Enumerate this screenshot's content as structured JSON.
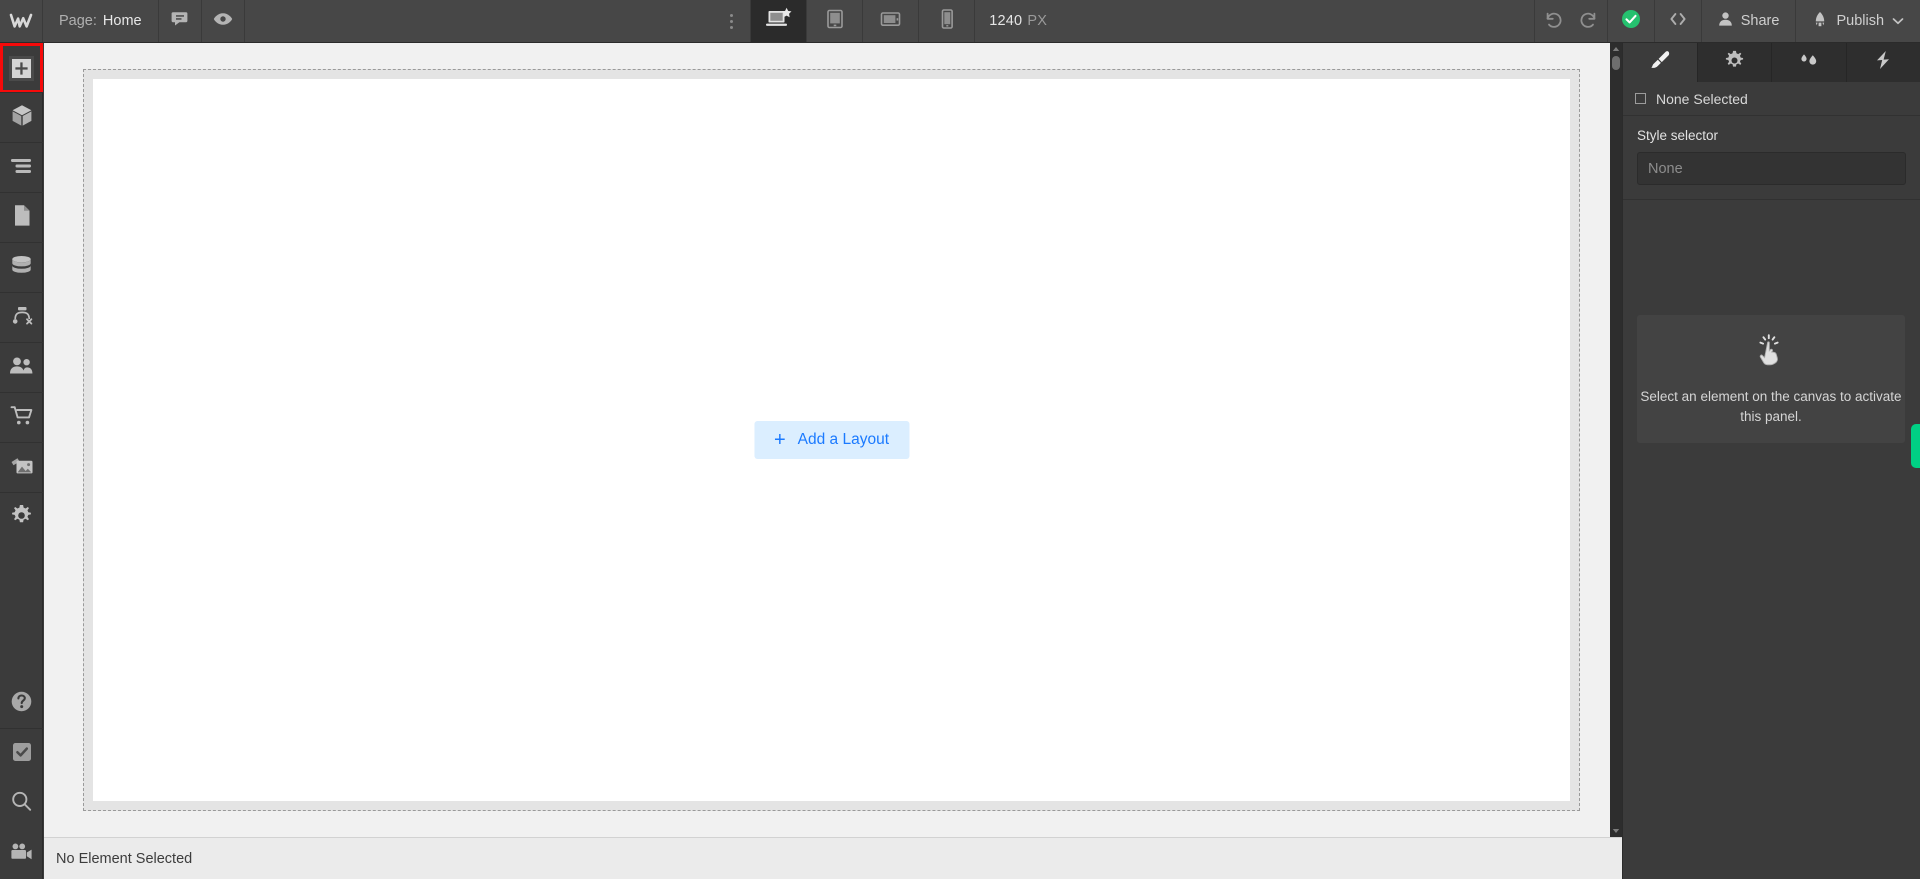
{
  "topbar": {
    "logo_icon": "webflow-logo-icon",
    "page_label": "Page:",
    "page_name": "Home",
    "comments_icon": "comment-icon",
    "preview_icon": "eye-preview-icon",
    "kebab_icon": "more-options-icon",
    "breakpoints": [
      {
        "name": "breakpoint-desktop-base",
        "icon": "desktop-star-icon",
        "active": true
      },
      {
        "name": "breakpoint-tablet",
        "icon": "tablet-icon",
        "active": false
      },
      {
        "name": "breakpoint-tablet-landscape",
        "icon": "tablet-landscape-icon",
        "active": false
      },
      {
        "name": "breakpoint-mobile",
        "icon": "mobile-icon",
        "active": false
      }
    ],
    "canvas_width_value": "1240",
    "canvas_width_unit": "PX",
    "undo_icon": "undo-icon",
    "redo_icon": "redo-icon",
    "status_icon": "saved-check-icon",
    "code_icon": "code-brackets-icon",
    "share_label": "Share",
    "share_icon": "person-icon",
    "publish_label": "Publish",
    "publish_icon": "rocket-icon",
    "publish_chevron": "chevron-down-icon",
    "accent_green": "#25c16f"
  },
  "left_rail": {
    "items": [
      {
        "name": "sidebar-item-add-elements",
        "icon": "plus-icon",
        "highlighted": true
      },
      {
        "name": "sidebar-item-components",
        "icon": "cube-icon",
        "highlighted": false
      },
      {
        "name": "sidebar-item-navigator",
        "icon": "navigator-layers-icon",
        "highlighted": false
      },
      {
        "name": "sidebar-item-pages",
        "icon": "page-document-icon",
        "highlighted": false
      },
      {
        "name": "sidebar-item-cms",
        "icon": "database-icon",
        "highlighted": false
      },
      {
        "name": "sidebar-item-logic",
        "icon": "logic-flow-icon",
        "highlighted": false
      },
      {
        "name": "sidebar-item-users",
        "icon": "people-icon",
        "highlighted": false
      },
      {
        "name": "sidebar-item-ecommerce",
        "icon": "shopping-cart-icon",
        "highlighted": false
      },
      {
        "name": "sidebar-item-assets",
        "icon": "images-assets-icon",
        "highlighted": false
      },
      {
        "name": "sidebar-item-settings",
        "icon": "gear-icon",
        "highlighted": false
      }
    ],
    "bottom_items": [
      {
        "name": "sidebar-item-help",
        "icon": "question-help-icon"
      },
      {
        "name": "sidebar-item-audit",
        "icon": "checkmark-audit-icon"
      },
      {
        "name": "sidebar-item-search",
        "icon": "search-icon"
      },
      {
        "name": "sidebar-item-video",
        "icon": "video-camera-icon"
      }
    ],
    "highlight_color": "#f60a0a"
  },
  "canvas": {
    "add_layout_label": "Add a Layout",
    "add_layout_icon": "plus-icon",
    "add_layout_bg": "#dbeeff",
    "add_layout_fg": "#1b7aff",
    "scrollbar_up_icon": "scroll-up-arrow-icon",
    "scrollbar_down_icon": "scroll-down-arrow-icon"
  },
  "right_panel": {
    "tabs": [
      {
        "name": "tab-style",
        "icon": "paintbrush-icon",
        "active": true
      },
      {
        "name": "tab-settings",
        "icon": "gear-icon",
        "active": false
      },
      {
        "name": "tab-interactions",
        "icon": "water-drops-icon",
        "active": false
      },
      {
        "name": "tab-effects",
        "icon": "lightning-bolt-icon",
        "active": false
      }
    ],
    "selection_label": "None Selected",
    "selection_icon": "empty-box-icon",
    "style_selector_label": "Style selector",
    "style_selector_placeholder": "None",
    "style_selector_value": "",
    "empty_state_icon": "tap-hand-icon",
    "empty_state_message": "Select an element on the canvas to activate this panel.",
    "green_tab_color": "#00d084"
  },
  "statusbar": {
    "message": "No Element Selected"
  }
}
